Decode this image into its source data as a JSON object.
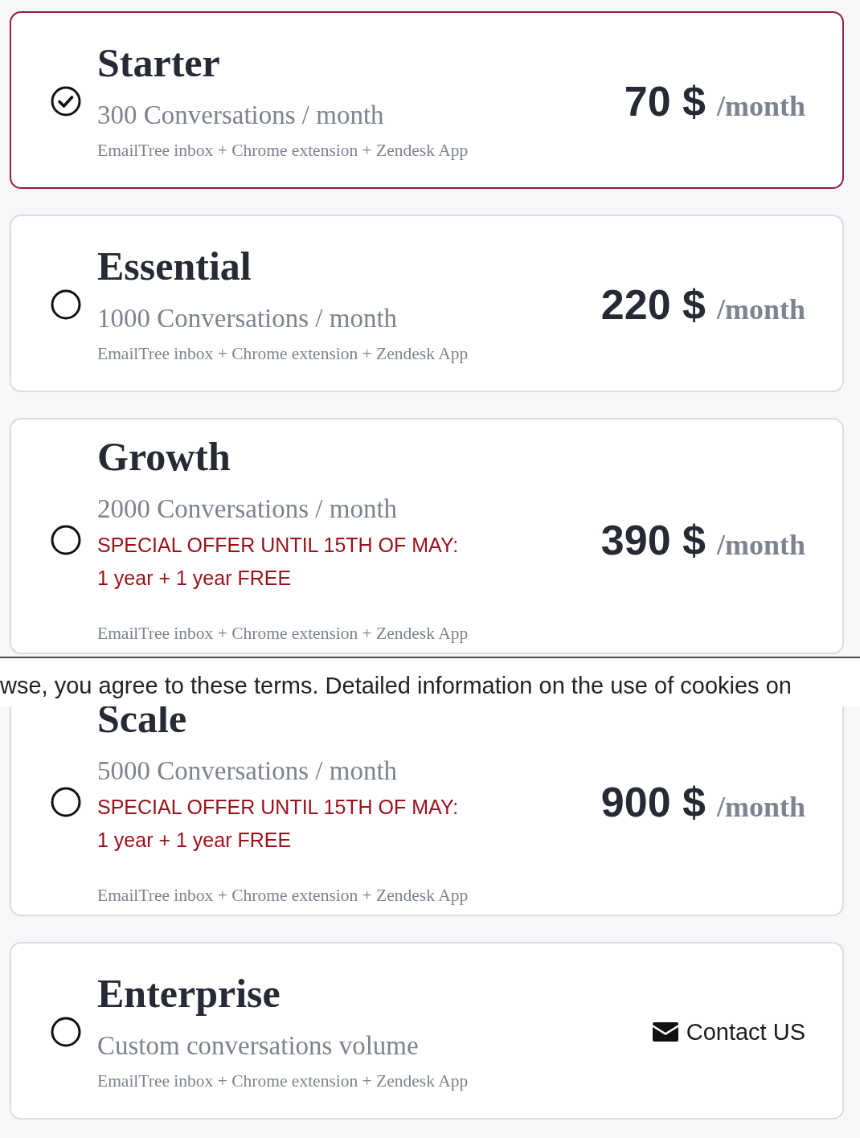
{
  "plans": [
    {
      "name": "Starter",
      "selected": true,
      "volume": "300 Conversations / month",
      "features": "EmailTree inbox + Chrome extension + Zendesk App",
      "pricing": {
        "kind": "price",
        "amount": "70 $",
        "period": "/month"
      }
    },
    {
      "name": "Essential",
      "selected": false,
      "volume": "1000 Conversations / month",
      "features": "EmailTree inbox + Chrome extension + Zendesk App",
      "pricing": {
        "kind": "price",
        "amount": "220 $",
        "period": "/month"
      }
    },
    {
      "name": "Growth",
      "selected": false,
      "volume": "2000 Conversations / month",
      "offer": [
        "SPECIAL OFFER UNTIL 15TH OF MAY:",
        "1 year + 1 year FREE"
      ],
      "features": "EmailTree inbox + Chrome extension + Zendesk App",
      "pricing": {
        "kind": "price",
        "amount": "390 $",
        "period": "/month"
      }
    },
    {
      "name": "Scale",
      "selected": false,
      "volume": "5000 Conversations / month",
      "offer": [
        "SPECIAL OFFER UNTIL 15TH OF MAY:",
        "1 year + 1 year FREE"
      ],
      "features": "EmailTree inbox + Chrome extension + Zendesk App",
      "pricing": {
        "kind": "price",
        "amount": "900 $",
        "period": "/month"
      }
    },
    {
      "name": "Enterprise",
      "selected": false,
      "volume": "Custom conversations volume",
      "features": "EmailTree inbox + Chrome extension + Zendesk App",
      "pricing": {
        "kind": "contact",
        "label": "Contact US"
      }
    }
  ],
  "cookie_banner": {
    "text": "wse, you agree to these terms. Detailed information on the use of cookies on"
  }
}
